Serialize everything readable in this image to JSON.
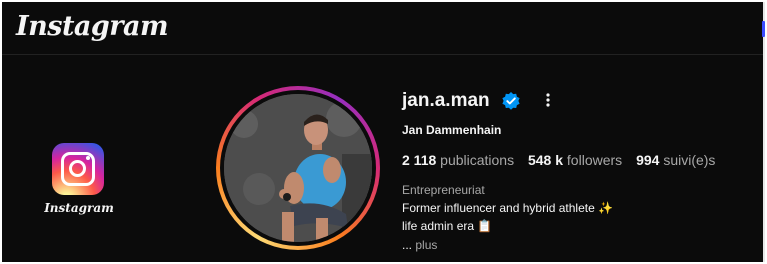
{
  "header": {
    "wordmark": "Instagram"
  },
  "app_icon": {
    "icon": "instagram-app-icon",
    "caption": "Instagram"
  },
  "profile": {
    "username": "jan.a.man",
    "verified": true,
    "full_name": "Jan Dammenhain",
    "stats": {
      "posts_count": "2 118",
      "posts_label": "publications",
      "followers_count": "548 k",
      "followers_label": "followers",
      "following_count": "994",
      "following_label": "suivi(e)s"
    },
    "category": "Entrepreneuriat",
    "bio": {
      "line1": "Former influencer and hybrid athlete ✨",
      "line2": "life admin era 📋"
    },
    "more_dots": "...",
    "more_label": "plus"
  },
  "colors": {
    "background": "#0b0b0b",
    "text_primary": "#f5f5f5",
    "text_secondary": "#a8a8a8",
    "verified_badge": "#0095f6"
  }
}
